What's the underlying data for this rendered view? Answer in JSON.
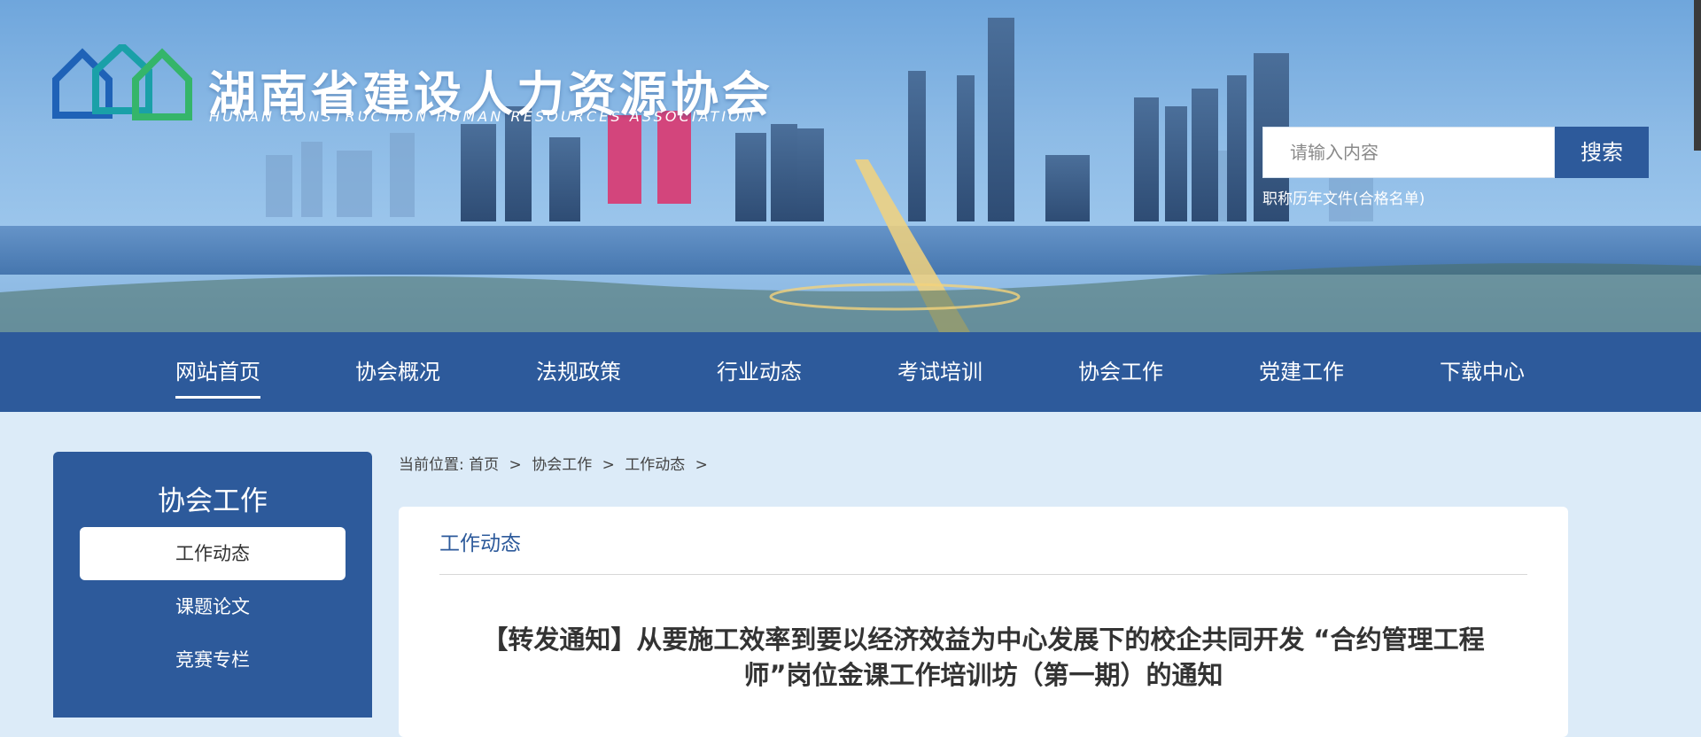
{
  "header": {
    "site_title": "湖南省建设人力资源协会",
    "site_subtitle": "HUNAN CONSTRUCTION HUMAN RESOURCES ASSOCIATION",
    "search_placeholder": "请输入内容",
    "search_button": "搜索",
    "search_link": "职称历年文件(合格名单)"
  },
  "nav": {
    "items": [
      {
        "label": "网站首页",
        "active": true
      },
      {
        "label": "协会概况"
      },
      {
        "label": "法规政策"
      },
      {
        "label": "行业动态"
      },
      {
        "label": "考试培训"
      },
      {
        "label": "协会工作"
      },
      {
        "label": "党建工作"
      },
      {
        "label": "下载中心"
      }
    ]
  },
  "sidebar": {
    "title": "协会工作",
    "items": [
      {
        "label": "工作动态",
        "active": true
      },
      {
        "label": "课题论文"
      },
      {
        "label": "竞赛专栏"
      }
    ]
  },
  "breadcrumb": {
    "prefix": "当前位置:",
    "items": [
      "首页",
      "协会工作",
      "工作动态"
    ],
    "separator": ">"
  },
  "content": {
    "section_title": "工作动态",
    "article_title_line1": "【转发通知】从要施工效率到要以经济效益为中心发展下的校企共同开发 “合约管理工程",
    "article_title_line2": "师”岗位金课工作培训坊（第一期）的通知"
  },
  "colors": {
    "primary": "#2d5a9b",
    "background": "#dcebf8",
    "logo_blue": "#1f62b7",
    "logo_green": "#35b56a"
  }
}
